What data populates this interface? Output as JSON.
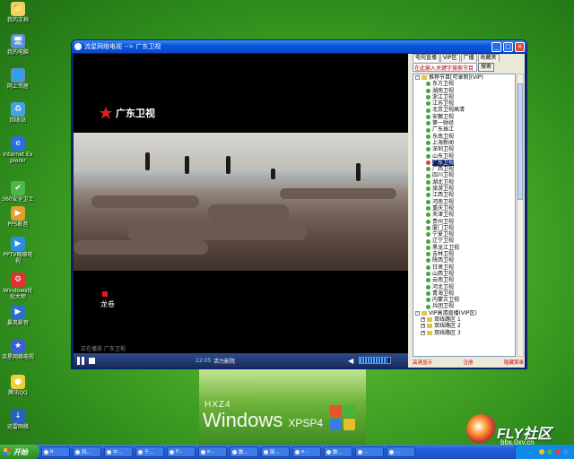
{
  "desktop": {
    "icons": [
      {
        "label": "我的文档",
        "color": "#f0d060",
        "glyph": "📁"
      },
      {
        "label": "我的电脑",
        "color": "#5a8fd8",
        "glyph": "🖥"
      },
      {
        "label": "网上邻居",
        "color": "#5a8fd8",
        "glyph": "🌐"
      },
      {
        "label": "回收站",
        "color": "#4aa0e0",
        "glyph": "♻"
      },
      {
        "label": "Internet Explorer",
        "color": "#2a6fd8",
        "glyph": "e"
      },
      {
        "label": "360安全卫士",
        "color": "#4ab84a",
        "glyph": "✔"
      },
      {
        "label": "PPS影音",
        "color": "#e0a030",
        "glyph": "▶"
      },
      {
        "label": "PPTV网络电视",
        "color": "#2a8fe0",
        "glyph": "▶"
      },
      {
        "label": "Windows优化大师",
        "color": "#e03030",
        "glyph": "⚙"
      },
      {
        "label": "暴风影音",
        "color": "#2a70c8",
        "glyph": "▶"
      },
      {
        "label": "流星网络电视",
        "color": "#3a5fd0",
        "glyph": "★"
      },
      {
        "label": "腾讯QQ",
        "color": "#f0d030",
        "glyph": "●"
      },
      {
        "label": "迅雷网络",
        "color": "#2a60c0",
        "glyph": "↓"
      }
    ]
  },
  "watermark": {
    "top_text": "HXZ4",
    "main_text": "Windows",
    "sub_text": "XPSP4"
  },
  "fly_logo": {
    "text": "FLY社区",
    "url": "bbs.0xy.cn"
  },
  "window": {
    "title": "流星网络电视 --> 广东卫视",
    "minimize": "_",
    "maximize": "□",
    "close": "×"
  },
  "player": {
    "channel_logo": "广东卫视",
    "corner_text": "龙卷",
    "status": "正在播放  广东卫视",
    "time": "22:05",
    "now_playing": "活力影院",
    "volume_percent": 90
  },
  "panel": {
    "tabs": [
      "电视直播",
      "VIP区",
      "广播",
      "收藏夹"
    ],
    "search_placeholder": "在此输入关键字搜索节目",
    "search_button": "搜索",
    "tree": [
      {
        "type": "group",
        "label": "推荐节目[可录制](VIP)",
        "toggle": "-"
      },
      {
        "type": "item",
        "label": "东方卫视"
      },
      {
        "type": "item",
        "label": "湖南卫视"
      },
      {
        "type": "item",
        "label": "浙江卫视"
      },
      {
        "type": "item",
        "label": "江苏卫视"
      },
      {
        "type": "item",
        "label": "北京卫视高清"
      },
      {
        "type": "item",
        "label": "安徽卫视"
      },
      {
        "type": "item",
        "label": "第一财经"
      },
      {
        "type": "item",
        "label": "广东珠江"
      },
      {
        "type": "item",
        "label": "东南卫视"
      },
      {
        "type": "item",
        "label": "上海新闻"
      },
      {
        "type": "item",
        "label": "深圳卫视"
      },
      {
        "type": "item",
        "label": "山东卫视"
      },
      {
        "type": "item",
        "label": "广东卫视",
        "selected": true,
        "live": true
      },
      {
        "type": "item",
        "label": "广西卫视"
      },
      {
        "type": "item",
        "label": "四川卫视"
      },
      {
        "type": "item",
        "label": "湖北卫视"
      },
      {
        "type": "item",
        "label": "旅游卫视"
      },
      {
        "type": "item",
        "label": "江西卫视"
      },
      {
        "type": "item",
        "label": "河南卫视"
      },
      {
        "type": "item",
        "label": "重庆卫视"
      },
      {
        "type": "item",
        "label": "天津卫视"
      },
      {
        "type": "item",
        "label": "贵州卫视"
      },
      {
        "type": "item",
        "label": "厦门卫视"
      },
      {
        "type": "item",
        "label": "宁夏卫视"
      },
      {
        "type": "item",
        "label": "辽宁卫视"
      },
      {
        "type": "item",
        "label": "黑龙江卫视"
      },
      {
        "type": "item",
        "label": "吉林卫视"
      },
      {
        "type": "item",
        "label": "陕西卫视"
      },
      {
        "type": "item",
        "label": "甘肃卫视"
      },
      {
        "type": "item",
        "label": "山西卫视"
      },
      {
        "type": "item",
        "label": "云南卫视"
      },
      {
        "type": "item",
        "label": "河北卫视"
      },
      {
        "type": "item",
        "label": "青海卫视"
      },
      {
        "type": "item",
        "label": "内蒙古卫视"
      },
      {
        "type": "item",
        "label": "兵团卫视"
      },
      {
        "type": "group",
        "label": "VIP高清直播(VIP区)",
        "toggle": "-"
      },
      {
        "type": "sub",
        "label": "双线路区 1",
        "toggle": "+"
      },
      {
        "type": "sub",
        "label": "双线路区 2",
        "toggle": "+"
      },
      {
        "type": "sub",
        "label": "双线路区 3",
        "toggle": "+"
      }
    ],
    "footer": [
      "高清显示",
      "注册",
      "隐藏菜单"
    ]
  },
  "taskbar": {
    "start": "开始",
    "tasks": [
      "b",
      "风...",
      "中...",
      "千...",
      "P...",
      "e...",
      "数...",
      "简...",
      "e...",
      "数...",
      "...",
      "..."
    ],
    "tray_colors": [
      "#f0c030",
      "#4ab84a",
      "#e04040",
      "#3a8fe0"
    ]
  },
  "colors": {
    "accent": "#0855dd",
    "live": "#e0402a"
  }
}
